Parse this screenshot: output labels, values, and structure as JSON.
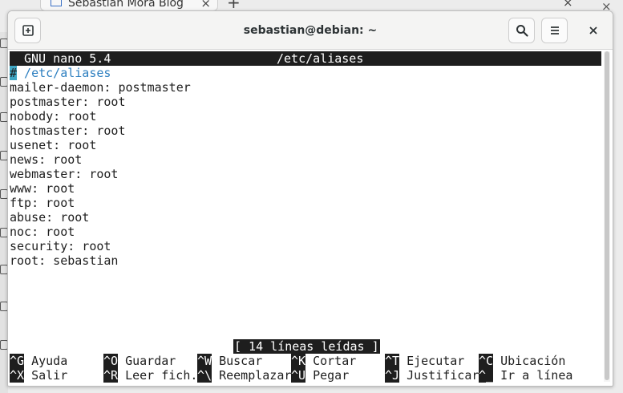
{
  "background": {
    "tab_title": "Sebastian Mora Blog",
    "tab_close": "×",
    "new_tab": "+",
    "close": "×"
  },
  "window": {
    "title": "sebastian@debian: ~",
    "buttons": {
      "new_tab": "new-tab-icon",
      "search": "search-icon",
      "menu": "hamburger-menu-icon",
      "close": "close-icon"
    }
  },
  "nano": {
    "version": "GNU nano 5.4",
    "filename": "/etc/aliases",
    "cursor_char": "#",
    "first_line_rest": " /etc/aliases",
    "lines": [
      "mailer-daemon: postmaster",
      "postmaster: root",
      "nobody: root",
      "hostmaster: root",
      "usenet: root",
      "news: root",
      "webmaster: root",
      "www: root",
      "ftp: root",
      "abuse: root",
      "noc: root",
      "security: root",
      "root: sebastian"
    ],
    "status": "[ 14 líneas leídas ]",
    "shortcuts_row1": [
      {
        "key": "^G",
        "label": " Ayuda"
      },
      {
        "key": "^O",
        "label": " Guardar"
      },
      {
        "key": "^W",
        "label": " Buscar"
      },
      {
        "key": "^K",
        "label": " Cortar"
      },
      {
        "key": "^T",
        "label": " Ejecutar"
      },
      {
        "key": "^C",
        "label": " Ubicación"
      }
    ],
    "shortcuts_row2": [
      {
        "key": "^X",
        "label": " Salir"
      },
      {
        "key": "^R",
        "label": " Leer fich."
      },
      {
        "key": "^\\",
        "label": " Reemplazar"
      },
      {
        "key": "^U",
        "label": " Pegar"
      },
      {
        "key": "^J",
        "label": " Justificar"
      },
      {
        "key": "^_",
        "label": " Ir a línea"
      }
    ]
  },
  "colors": {
    "terminal_bg": "#ffffff",
    "inverse_bg": "#1e1e1e",
    "cursor": "#3ea6c4"
  }
}
